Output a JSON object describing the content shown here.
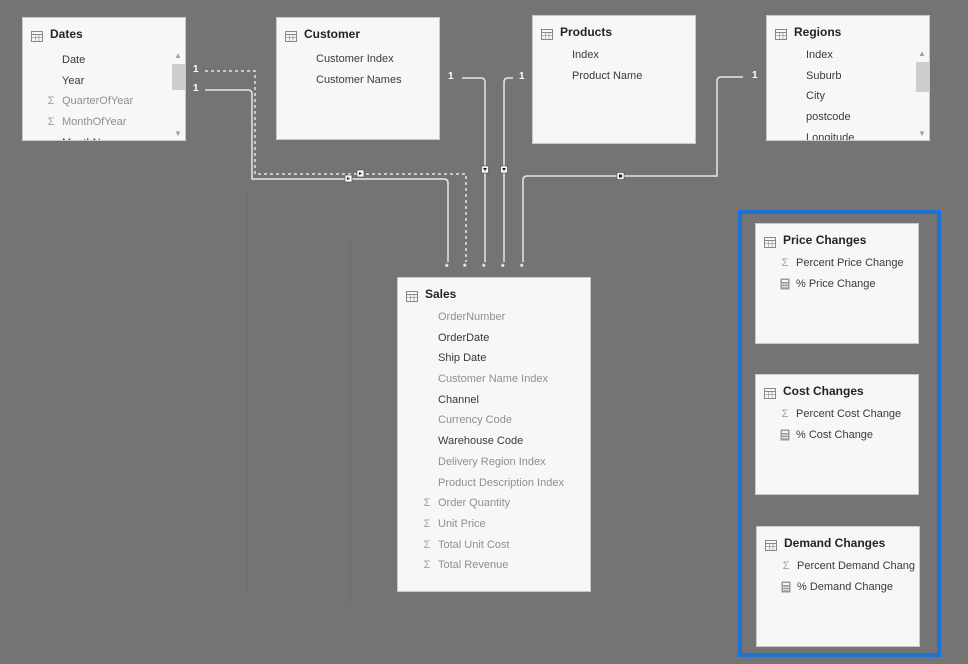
{
  "tables": {
    "dates": {
      "title": "Dates",
      "icon": "table-icon",
      "fields": [
        {
          "label": "Date",
          "icon": "",
          "tone": "dark"
        },
        {
          "label": "Year",
          "icon": "",
          "tone": "dark"
        },
        {
          "label": "QuarterOfYear",
          "icon": "sigma-icon",
          "tone": "light"
        },
        {
          "label": "MonthOfYear",
          "icon": "sigma-icon",
          "tone": "light"
        },
        {
          "label": "MonthName",
          "icon": "",
          "tone": "dark"
        }
      ]
    },
    "customer": {
      "title": "Customer",
      "icon": "table-icon",
      "fields": [
        {
          "label": "Customer Index",
          "icon": "",
          "tone": "dark"
        },
        {
          "label": "Customer Names",
          "icon": "",
          "tone": "dark"
        }
      ]
    },
    "products": {
      "title": "Products",
      "icon": "table-icon",
      "fields": [
        {
          "label": "Index",
          "icon": "",
          "tone": "dark"
        },
        {
          "label": "Product Name",
          "icon": "",
          "tone": "dark"
        }
      ]
    },
    "regions": {
      "title": "Regions",
      "icon": "table-icon",
      "fields": [
        {
          "label": "Index",
          "icon": "",
          "tone": "dark"
        },
        {
          "label": "Suburb",
          "icon": "",
          "tone": "dark"
        },
        {
          "label": "City",
          "icon": "",
          "tone": "dark"
        },
        {
          "label": "postcode",
          "icon": "",
          "tone": "dark"
        },
        {
          "label": "Longitude",
          "icon": "",
          "tone": "dark"
        }
      ]
    },
    "sales": {
      "title": "Sales",
      "icon": "table-icon",
      "fields": [
        {
          "label": "OrderNumber",
          "icon": "",
          "tone": "light"
        },
        {
          "label": "OrderDate",
          "icon": "",
          "tone": "dark"
        },
        {
          "label": "Ship Date",
          "icon": "",
          "tone": "dark"
        },
        {
          "label": "Customer Name Index",
          "icon": "",
          "tone": "light"
        },
        {
          "label": "Channel",
          "icon": "",
          "tone": "dark"
        },
        {
          "label": "Currency Code",
          "icon": "",
          "tone": "light"
        },
        {
          "label": "Warehouse Code",
          "icon": "",
          "tone": "dark"
        },
        {
          "label": "Delivery Region Index",
          "icon": "",
          "tone": "light"
        },
        {
          "label": "Product Description Index",
          "icon": "",
          "tone": "light"
        },
        {
          "label": "Order Quantity",
          "icon": "sigma-icon",
          "tone": "light"
        },
        {
          "label": "Unit Price",
          "icon": "sigma-icon",
          "tone": "light"
        },
        {
          "label": "Total Unit Cost",
          "icon": "sigma-icon",
          "tone": "light"
        },
        {
          "label": "Total Revenue",
          "icon": "sigma-icon",
          "tone": "light"
        }
      ]
    },
    "price_changes": {
      "title": "Price Changes",
      "icon": "table-icon",
      "fields": [
        {
          "label": "Percent Price Change",
          "icon": "sigma-icon",
          "tone": "dark"
        },
        {
          "label": "% Price Change",
          "icon": "calculator-icon",
          "tone": "dark"
        }
      ]
    },
    "cost_changes": {
      "title": "Cost Changes",
      "icon": "table-icon",
      "fields": [
        {
          "label": "Percent Cost Change",
          "icon": "sigma-icon",
          "tone": "dark"
        },
        {
          "label": "% Cost Change",
          "icon": "calculator-icon",
          "tone": "dark"
        }
      ]
    },
    "demand_changes": {
      "title": "Demand Changes",
      "icon": "table-icon",
      "fields": [
        {
          "label": "Percent Demand Chang",
          "icon": "sigma-icon",
          "tone": "dark"
        },
        {
          "label": "% Demand Change",
          "icon": "calculator-icon",
          "tone": "dark"
        }
      ]
    }
  },
  "relationships": {
    "one_label": "1",
    "many_label": "*"
  },
  "colors": {
    "canvas": "#747474",
    "selection": "#1b73d4",
    "card": "#f7f7f7",
    "line": "#e6e6e6"
  }
}
